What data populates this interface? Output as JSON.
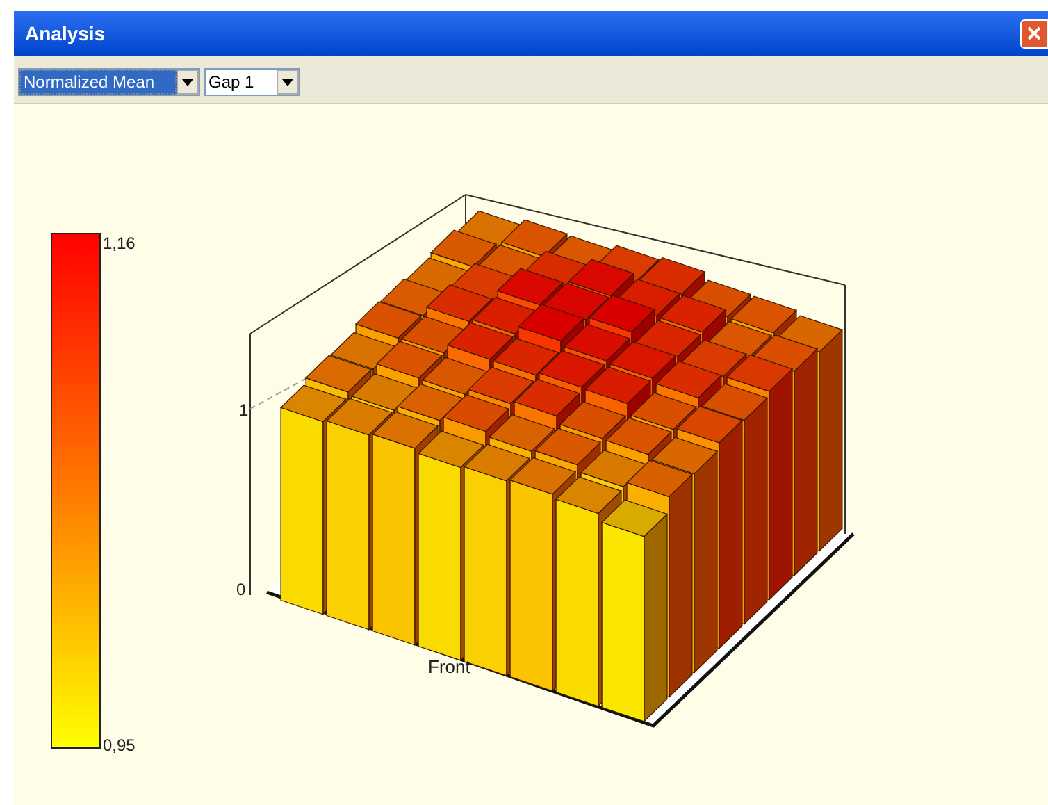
{
  "window": {
    "title": "Analysis"
  },
  "toolbar": {
    "dropdowns": [
      {
        "value": "Normalized Mean",
        "focused": true
      },
      {
        "value": "Gap 1",
        "focused": false
      }
    ]
  },
  "legend": {
    "max_label": "1,16",
    "min_label": "0,95"
  },
  "chart": {
    "y_tick_labels": [
      "1",
      "0"
    ],
    "xlabel": "Front"
  }
}
